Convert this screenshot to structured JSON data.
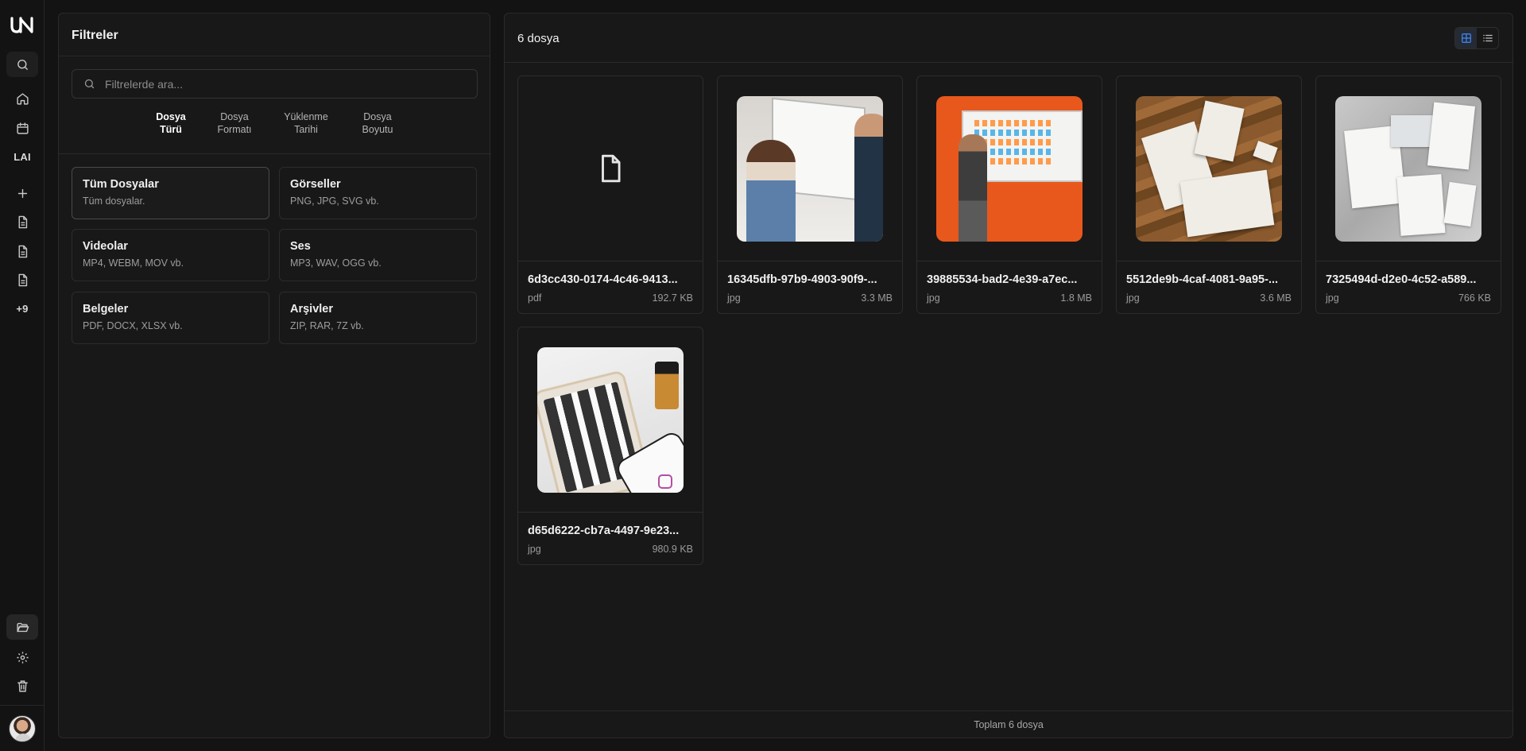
{
  "rail": {
    "logo": "UN",
    "items": [
      {
        "name": "search-icon"
      },
      {
        "name": "home-icon"
      },
      {
        "name": "calendar-icon"
      },
      {
        "name": "lai-logo",
        "label": "LAI"
      },
      {
        "name": "plus-icon"
      },
      {
        "name": "document-icon"
      },
      {
        "name": "document-icon"
      },
      {
        "name": "document-icon"
      }
    ],
    "more_label": "+9",
    "bottom": [
      {
        "name": "folder-open-icon"
      },
      {
        "name": "gear-icon"
      },
      {
        "name": "trash-icon"
      }
    ]
  },
  "filters": {
    "title": "Filtreler",
    "search_placeholder": "Filtrelerde ara...",
    "tabs": [
      {
        "line1": "Dosya",
        "line2": "Türü",
        "active": true
      },
      {
        "line1": "Dosya",
        "line2": "Formatı",
        "active": false
      },
      {
        "line1": "Yüklenme",
        "line2": "Tarihi",
        "active": false
      },
      {
        "line1": "Dosya",
        "line2": "Boyutu",
        "active": false
      }
    ],
    "categories": [
      {
        "title": "Tüm Dosyalar",
        "desc": "Tüm dosyalar.",
        "active": true
      },
      {
        "title": "Görseller",
        "desc": "PNG, JPG, SVG vb.",
        "active": false
      },
      {
        "title": "Videolar",
        "desc": "MP4, WEBM, MOV vb.",
        "active": false
      },
      {
        "title": "Ses",
        "desc": "MP3, WAV, OGG vb.",
        "active": false
      },
      {
        "title": "Belgeler",
        "desc": "PDF, DOCX, XLSX vb.",
        "active": false
      },
      {
        "title": "Arşivler",
        "desc": "ZIP, RAR, 7Z vb.",
        "active": false
      }
    ]
  },
  "files": {
    "count_label": "6 dosya",
    "view_mode": "grid",
    "items": [
      {
        "name": "6d3cc430-0174-4c46-9413...",
        "ext": "pdf",
        "size": "192.7 KB",
        "thumb": "document-icon"
      },
      {
        "name": "16345dfb-97b9-4903-90f9-...",
        "ext": "jpg",
        "size": "3.3 MB",
        "thumb": "whiteboard-photo"
      },
      {
        "name": "39885534-bad2-4e39-a7ec...",
        "ext": "jpg",
        "size": "1.8 MB",
        "thumb": "orange-wall-photo"
      },
      {
        "name": "5512de9b-4caf-4081-9a95-...",
        "ext": "jpg",
        "size": "3.6 MB",
        "thumb": "papers-on-wood-photo"
      },
      {
        "name": "7325494d-d2e0-4c52-a589...",
        "ext": "jpg",
        "size": "766 KB",
        "thumb": "stationery-marble-photo"
      },
      {
        "name": "d65d6222-cb7a-4497-9e23...",
        "ext": "jpg",
        "size": "980.9 KB",
        "thumb": "tablet-photo"
      }
    ],
    "footer": "Toplam 6 dosya"
  },
  "colors": {
    "background": "#131313",
    "panel": "#181818",
    "border": "#2a2a2a",
    "accent": "#3f8cff"
  }
}
